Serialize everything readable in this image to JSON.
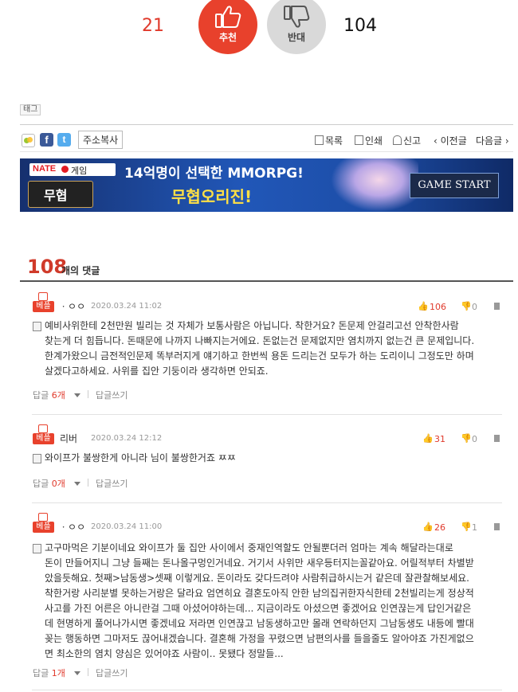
{
  "vote": {
    "up_count": "21",
    "up_label": "추천",
    "down_label": "반대",
    "down_count": "104"
  },
  "tag": {
    "label": "태그"
  },
  "share": {
    "facebook": "f",
    "twitter": "t",
    "copy_url": "주소복사"
  },
  "tools": {
    "list": "목록",
    "print": "인쇄",
    "report": "신고",
    "prev": "‹ 이전글",
    "next": "다음글 ›"
  },
  "banner": {
    "nate": "NATE",
    "game": "게임",
    "line1": "14억명이 선택한 MMORPG!",
    "line2": "무협오리진!",
    "logo_text": "무협",
    "cta": "GAME START"
  },
  "comments_header": {
    "count": "108",
    "label": "개의 댓글"
  },
  "comments": [
    {
      "badge": "베플",
      "author": "ㆍㅇㅇ",
      "date": "2020.03.24 11:02",
      "up": "106",
      "down": "0",
      "lines": [
        "예비사위한테 2천만원 빌리는 것 자체가 보통사람은 아닙니다. 착한거요? 돈문제 안걸리고선 안착한사람",
        "찾는게 더 힘듭니다. 돈때문에 나까지 나빠지는거에요. 돈없는건 문제없지만 염치까지 없는건 큰 문제입니다.",
        "한계가왔으니 금전적인문제 똑부러지게 얘기하고 한번씩 용돈 드리는건 모두가 하는 도리이니 그정도만 하며",
        "살겠다고하세요. 사위를 집안 기둥이라 생각하면 안되죠."
      ],
      "reply_label": "답글",
      "reply_count": "6개",
      "write_label": "답글쓰기"
    },
    {
      "badge": "베플",
      "author": "리버",
      "date": "2020.03.24 12:12",
      "up": "31",
      "down": "0",
      "lines": [
        "와이프가 불쌍한게 아니라 님이 불쌍한거죠 ㅉㅉ"
      ],
      "reply_label": "답글",
      "reply_count": "0개",
      "write_label": "답글쓰기"
    },
    {
      "badge": "베플",
      "author": "ㆍㅇㅇ",
      "date": "2020.03.24 11:00",
      "up": "26",
      "down": "1",
      "lines": [
        "고구마먹은 기분이네요 와이프가 둘 집안 사이에서 중재인역할도 안될뿐더러 엄마는 계속 해달라는대로",
        "돈이 만들어지니 그냥 들째는 돈나올구멍인거네요. 거기서 사위만 새우등터지는꼴같아요. 어릴적부터 차별받",
        "았을듯해요. 첫째>남동생>셋째 이렇게요. 돈이라도 갖다드려야 사람취급하시는거 같은데 잘관찰해보세요.",
        "착한거랑 사리분별 못하는거랑은 달라요 엄연히요 결혼도아직 안한 남의집귀한자식한테 2천빌리는게 정상적",
        "사고를 가진 어른은 아니란걸 그때 아셨어야하는데... 지금이라도 아셨으면 좋겠어요 인연끊는게 답인거같은",
        "데 현명하게 풀어나가시면 좋겠네요 저라면 인연끊고 남동생하고만 몰래 연락하던지 그남동생도 내등에 빨대",
        "꽂는 행동하면 그마저도 끊어내겠습니다. 결혼해 가정을 꾸렸으면 남편의사를 들을줄도 알아야죠 가진게없으",
        "면 최소한의 염치 양심은 있어야죠 사람이.. 못됐다 정말들..."
      ],
      "reply_label": "답글",
      "reply_count": "1개",
      "write_label": "답글쓰기"
    }
  ]
}
